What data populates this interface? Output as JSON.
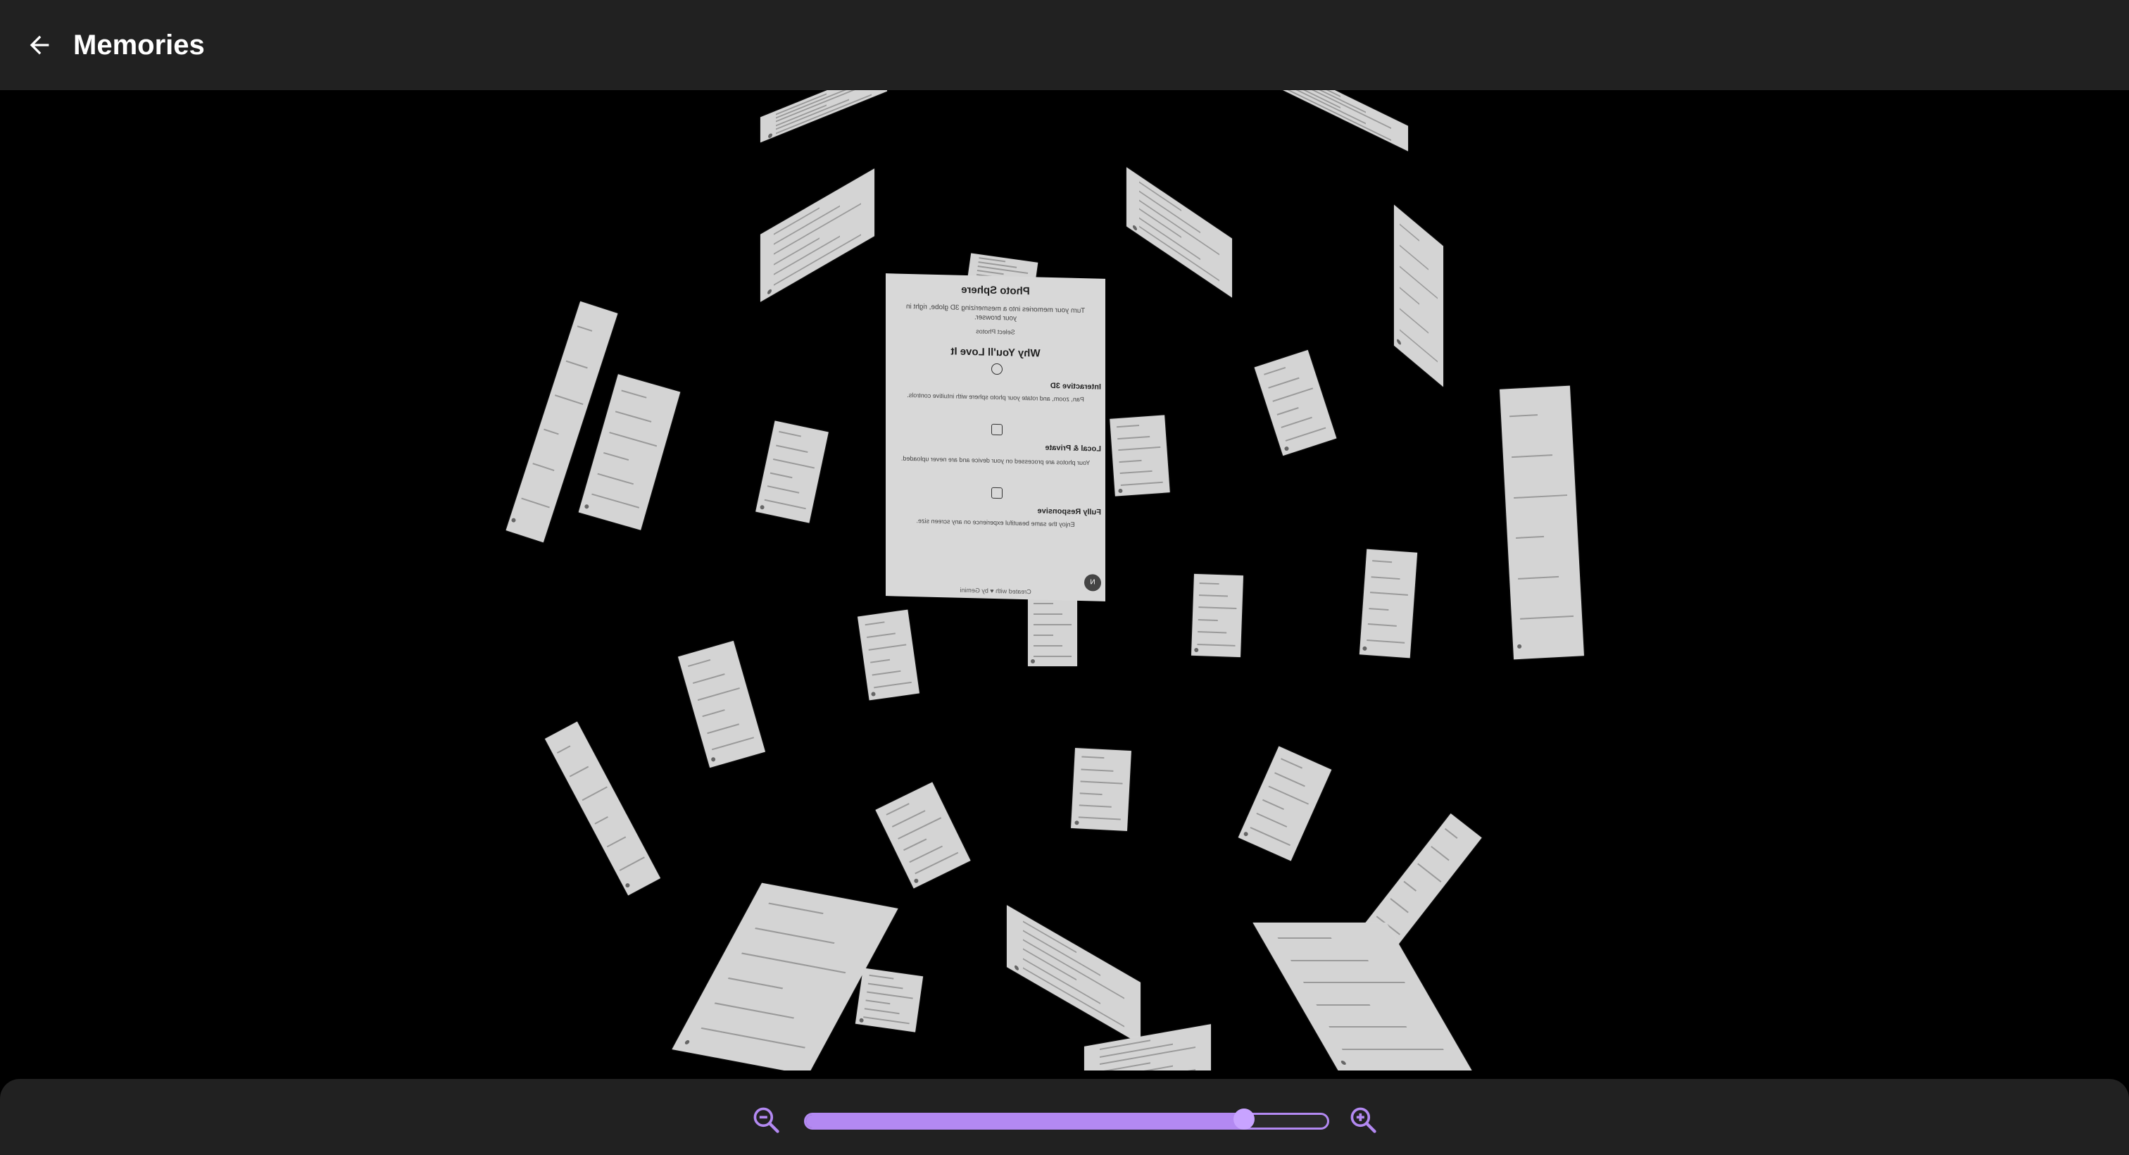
{
  "header": {
    "title": "Memories",
    "back_icon": "arrow-left-icon"
  },
  "main_card": {
    "title": "Photo Sphere",
    "subtitle": "Turn your memories into a mesmerizing 3D globe, right in your browser.",
    "select_label": "Select Photos",
    "section_title": "Why You'll Love It",
    "features": [
      {
        "title": "Interactive 3D",
        "text": "Pan, zoom, and rotate your photo sphere with intuitive controls."
      },
      {
        "title": "Local & Private",
        "text": "Your photos are processed on your device and are never uploaded."
      },
      {
        "title": "Fully Responsive",
        "text": "Enjoy the same beautiful experience on any screen size."
      }
    ],
    "footer": "Created with ♥ by Gemini",
    "badge": "N"
  },
  "zoom": {
    "zoom_out_icon": "zoom-out-icon",
    "zoom_in_icon": "zoom-in-icon",
    "level": 0.84,
    "accent_color": "#b389f2"
  }
}
